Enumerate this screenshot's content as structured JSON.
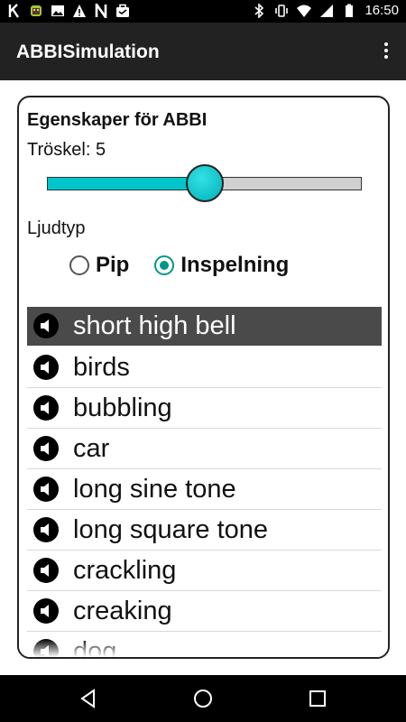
{
  "status_bar": {
    "time": "16:50",
    "left_icons": [
      "k-icon",
      "android-debug-icon",
      "image-icon",
      "warning-icon",
      "n-icon",
      "briefcase-icon"
    ],
    "right_icons": [
      "bluetooth-icon",
      "vibrate-icon",
      "wifi-icon",
      "signal-icon",
      "battery-icon"
    ]
  },
  "app_bar": {
    "title": "ABBISimulation",
    "overflow_icon": "overflow-menu-icon"
  },
  "properties": {
    "title": "Egenskaper för ABBI",
    "threshold_label": "Tröskel: 5",
    "slider_value_fraction": 0.5,
    "sound_type_label": "Ljudtyp",
    "radio_options": [
      {
        "label": "Pip",
        "checked": false
      },
      {
        "label": "Inspelning",
        "checked": true
      }
    ]
  },
  "sounds": [
    {
      "label": "short high bell",
      "selected": true
    },
    {
      "label": "birds",
      "selected": false
    },
    {
      "label": "bubbling",
      "selected": false
    },
    {
      "label": "car",
      "selected": false
    },
    {
      "label": "long sine tone",
      "selected": false
    },
    {
      "label": "long square tone",
      "selected": false
    },
    {
      "label": "crackling",
      "selected": false
    },
    {
      "label": "creaking",
      "selected": false
    },
    {
      "label": "dog",
      "selected": false
    }
  ],
  "colors": {
    "accent": "#00c6cc",
    "radio_checked": "#009688",
    "selected_row": "#4a4a4a",
    "app_bar": "#222222"
  },
  "nav_bar": {
    "back": "back-icon",
    "home": "home-icon",
    "recents": "recents-icon"
  }
}
